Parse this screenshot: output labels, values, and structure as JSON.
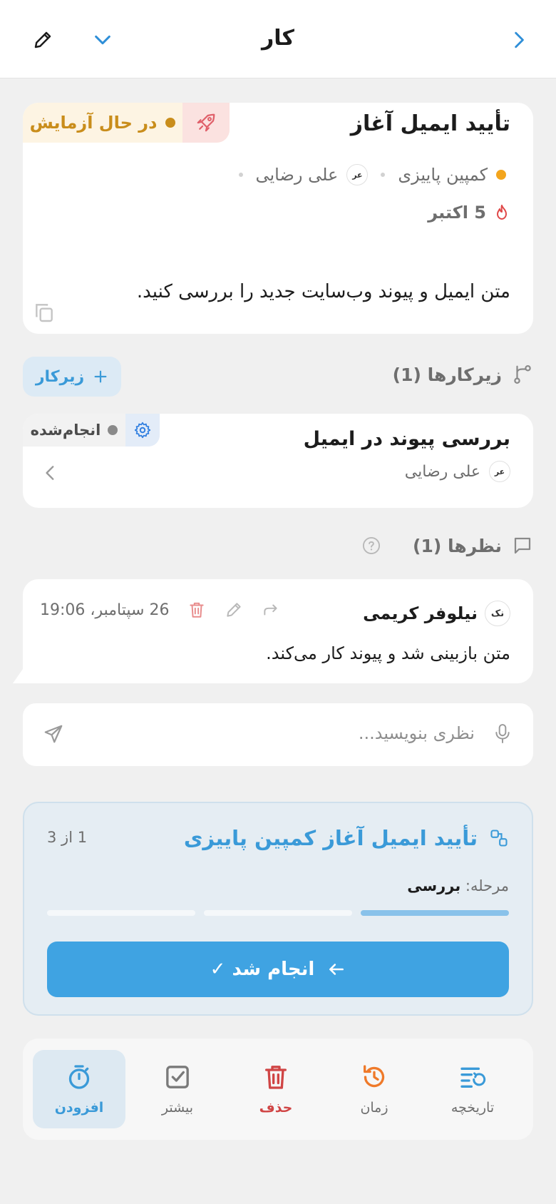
{
  "header": {
    "title": "کار"
  },
  "task": {
    "title": "تأیید ایمیل آغاز",
    "status": "در حال آزمایش",
    "campaign": "کمپین پاییزی",
    "assignee_initials": "عر",
    "assignee": "علی رضایی",
    "due_date": "5 اکتبر",
    "description": "متن ایمیل و پیوند وب‌سایت جدید را بررسی کنید.",
    "colors": {
      "status": "#c98d1b",
      "campaign": "#f3a51d",
      "rocket": "#e0606a",
      "flame": "#e04848"
    }
  },
  "subtasks": {
    "header": "زیرکارها (1)",
    "add_label": "زیرکار",
    "items": [
      {
        "title": "بررسی پیوند در ایمیل",
        "status": "انجام‌شده",
        "assignee_initials": "عر",
        "assignee": "علی رضایی"
      }
    ]
  },
  "comments": {
    "header": "نظرها (1)",
    "items": [
      {
        "author_initials": "نک",
        "author": "نیلوفر کریمی",
        "time": "26 سپتامبر، 19:06",
        "text": "متن بازبینی شد و پیوند کار می‌کند."
      }
    ],
    "input_placeholder": "نظری بنویسید..."
  },
  "workflow": {
    "title": "تأیید ایمیل آغاز کمپین پاییزی",
    "step_count": "1 از 3",
    "stage_label": "مرحله:",
    "stage_value": "بررسی",
    "progress_step": 1,
    "progress_total": 3,
    "done_button": "انجام شد ✓"
  },
  "bottom_bar": {
    "add": "افزودن",
    "more": "بیشتر",
    "delete": "حذف",
    "time": "زمان",
    "history": "تاریخچه"
  }
}
